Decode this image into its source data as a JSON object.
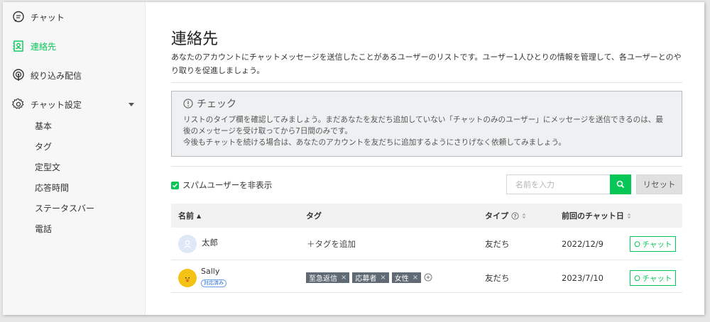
{
  "sidebar": {
    "chat": "チャット",
    "contacts": "連絡先",
    "narrowcast": "絞り込み配信",
    "chat_settings": "チャット設定",
    "sub_items": [
      "基本",
      "タグ",
      "定型文",
      "応答時間",
      "ステータスバー",
      "電話"
    ]
  },
  "main": {
    "title": "連絡先",
    "description": "あなたのアカウントにチャットメッセージを送信したことがあるユーザーのリストです。ユーザー1人ひとりの情報を管理して、各ユーザーとのやり取りを促進しましょう。",
    "notice": {
      "heading": "チェック",
      "line1": "リストのタイプ欄を確認してみましょう。まだあなたを友だち追加していない「チャットのみのユーザー」にメッセージを送信できるのは、最後のメッセージを受け取ってから7日間のみです。",
      "line2": "今後もチャットを続ける場合は、あなたのアカウントを友だちに追加するようにさりげなく依頼してみましょう。"
    },
    "spam_label": "スパムユーザーを非表示",
    "search_placeholder": "名前を入力",
    "reset_label": "リセット",
    "columns": {
      "name": "名前",
      "tags": "タグ",
      "type": "タイプ",
      "last_chat": "前回のチャット日"
    },
    "rows": [
      {
        "name": "太郎",
        "add_tag": "＋タグを追加",
        "type": "友だち",
        "date": "2022/12/9",
        "chat_label": "チャット"
      },
      {
        "name": "Sally",
        "badge": "対応済み",
        "tags": [
          "至急返信",
          "応募者",
          "女性"
        ],
        "type": "友だち",
        "date": "2023/7/10",
        "chat_label": "チャット"
      }
    ]
  },
  "colors": {
    "accent": "#06c755",
    "tag_bg": "#5f6a74",
    "badge": "#1566d8"
  },
  "icons": {
    "chat": "chat-bubble-icon",
    "contacts": "contact-card-icon",
    "narrowcast": "broadcast-icon",
    "settings": "gear-icon",
    "search": "search-icon",
    "notice": "info-circle-icon"
  }
}
